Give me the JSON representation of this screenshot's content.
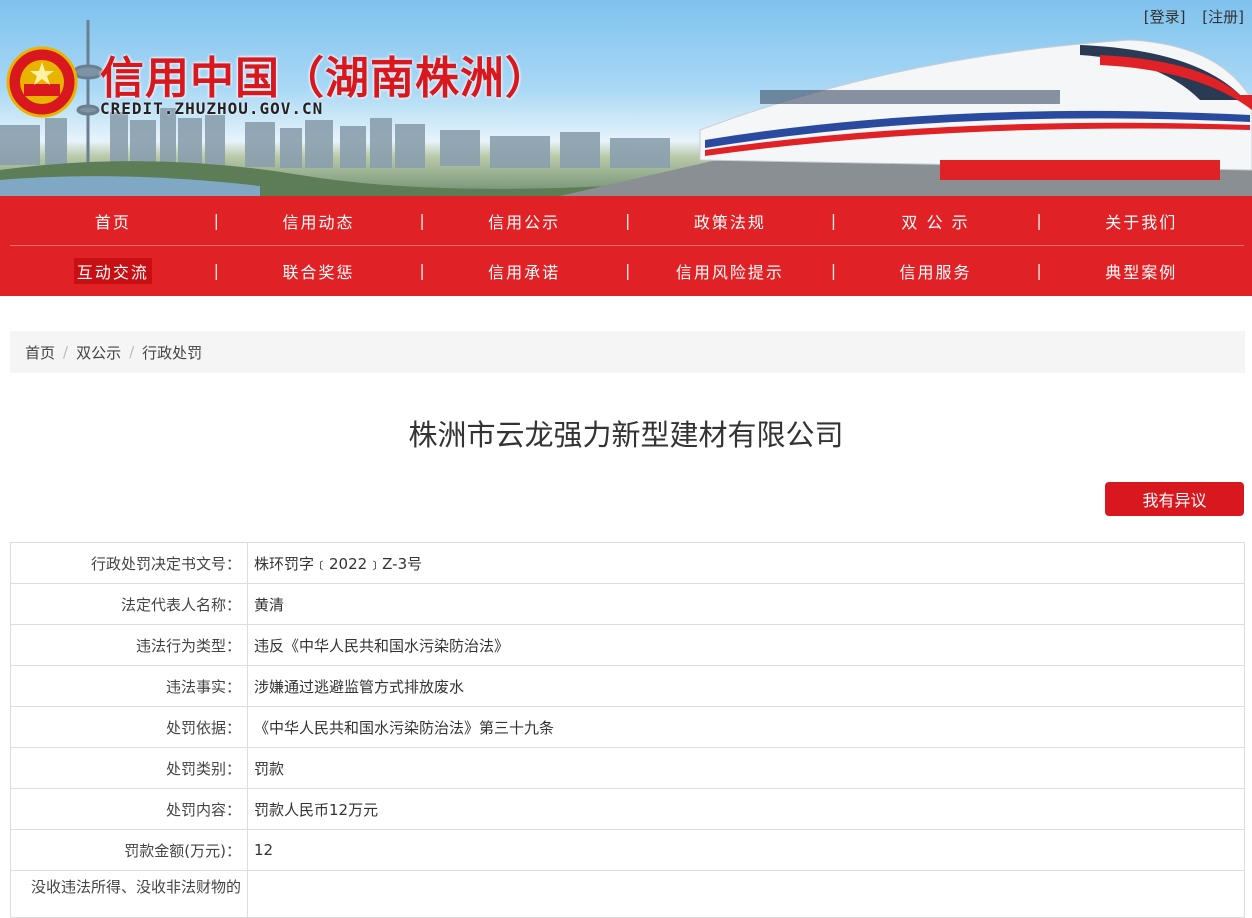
{
  "header": {
    "login_label": "[登录]",
    "register_label": "[注册]",
    "site_title": "信用中国（湖南株洲）",
    "site_url": "CREDIT.ZHUZHOU.GOV.CN"
  },
  "nav": {
    "row1": [
      "首页",
      "信用动态",
      "信用公示",
      "政策法规",
      "双 公 示",
      "关于我们"
    ],
    "row2": [
      "互动交流",
      "联合奖惩",
      "信用承诺",
      "信用风险提示",
      "信用服务",
      "典型案例"
    ]
  },
  "breadcrumb": [
    "首页",
    "双公示",
    "行政处罚"
  ],
  "page_title": "株洲市云龙强力新型建材有限公司",
  "objection_button": "我有异议",
  "details": [
    {
      "label": "行政处罚决定书文号：",
      "value": "株环罚字﹝2022﹞Z-3号"
    },
    {
      "label": "法定代表人名称：",
      "value": "黄清"
    },
    {
      "label": "违法行为类型：",
      "value": "违反《中华人民共和国水污染防治法》"
    },
    {
      "label": "违法事实：",
      "value": "涉嫌通过逃避监管方式排放废水"
    },
    {
      "label": "处罚依据：",
      "value": "《中华人民共和国水污染防治法》第三十九条"
    },
    {
      "label": "处罚类别：",
      "value": "罚款"
    },
    {
      "label": "处罚内容：",
      "value": "罚款人民币12万元"
    },
    {
      "label": "罚款金额(万元)：",
      "value": "12"
    },
    {
      "label": "没收违法所得、没收非法财物的",
      "value": ""
    }
  ],
  "colors": {
    "brand_red": "#e02125",
    "button_red": "#d9171e"
  }
}
